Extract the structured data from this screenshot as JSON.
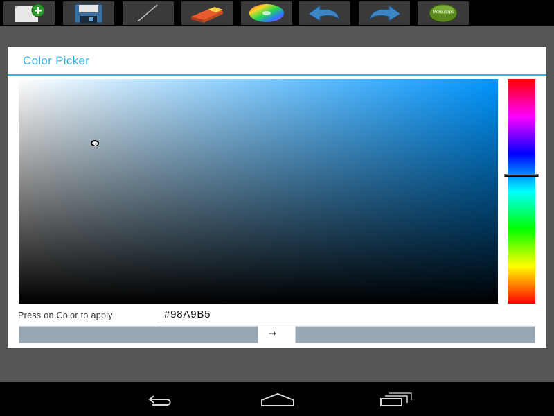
{
  "toolbar": {
    "items": [
      {
        "name": "new-canvas"
      },
      {
        "name": "save"
      },
      {
        "name": "brush"
      },
      {
        "name": "eraser"
      },
      {
        "name": "color-wheel"
      },
      {
        "name": "undo"
      },
      {
        "name": "redo"
      },
      {
        "name": "more-apps",
        "label": "More Apps"
      }
    ]
  },
  "dialog": {
    "title": "Color Picker",
    "hint": "Press on Color to apply",
    "hex_value": "#98A9B5",
    "arrow": "→",
    "selected_hue_color": "#0096ff",
    "hue_level": 0.43,
    "old_color": "#98A9B5",
    "new_color": "#98A9B5"
  },
  "navbar": {
    "items": [
      {
        "name": "back-icon"
      },
      {
        "name": "home-icon"
      },
      {
        "name": "recent-apps-icon"
      }
    ]
  },
  "colors": {
    "accent": "#33b5e5",
    "app_background": "#555555",
    "toolbar_button": "#3a3a3a"
  }
}
